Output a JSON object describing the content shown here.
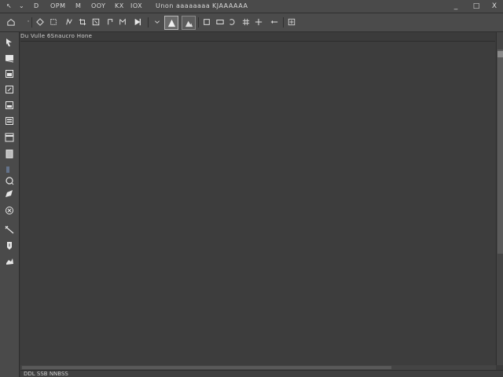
{
  "menubar": {
    "items": [
      "D",
      "OPM",
      "M",
      "OOY",
      "KX",
      "IOX",
      "Unon",
      "aaaaaaaa",
      "KJAAAAAA"
    ],
    "window_controls": [
      "_",
      "□",
      "X"
    ]
  },
  "toolbar": {
    "icons": [
      "home-icon",
      "move-icon",
      "marquee-icon",
      "lasso-icon",
      "crop-icon",
      "frame-icon",
      "brush-icon",
      "stamp-icon",
      "triangle-icon",
      "mountain-icon",
      "square-icon",
      "link-icon",
      "rotate-icon",
      "grid-icon",
      "minus-icon",
      "plus-box-icon"
    ]
  },
  "document": {
    "tab_title": "Du Vulle 6Snaucro Hone"
  },
  "tools": {
    "items": [
      "move-tool-icon",
      "marquee-tool-icon",
      "lasso-tool-icon",
      "crop-tool-icon",
      "eyedropper-tool-icon",
      "heal-tool-icon",
      "brush-tool-icon",
      "stamp-tool-icon",
      "eraser-tool-icon",
      "gradient-tool-icon",
      "pen-tool-icon",
      "text-tool-icon",
      "shape-tool-icon",
      "hand-tool-icon",
      "zoom-tool-icon"
    ]
  },
  "status": {
    "text": "DDL SSB NNBSS"
  }
}
